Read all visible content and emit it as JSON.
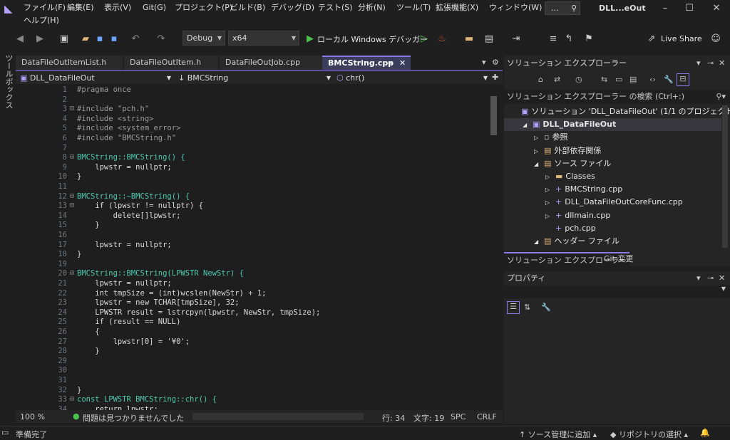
{
  "menu": [
    "ファイル(F)",
    "編集(E)",
    "表示(V)",
    "Git(G)",
    "プロジェクト(P)",
    "ビルド(B)",
    "デバッグ(D)",
    "テスト(S)",
    "分析(N)",
    "ツール(T)",
    "拡張機能(X)",
    "ウィンドウ(W)",
    "ヘルプ(H)"
  ],
  "search": {
    "label": "..."
  },
  "title": "DLL...eOut",
  "toolbar": {
    "config": "Debug",
    "platform": "x64",
    "run_label": "ローカル Windows デバッガー",
    "live_share": "Live Share"
  },
  "toolbox_label": "ツールボックス",
  "tabs": [
    "DataFileOutItemList.h",
    "DataFileOutItem.h",
    "DataFileOutJob.cpp",
    "BMCString.cpp"
  ],
  "nav": {
    "project": "DLL_DataFileOut",
    "scope": "BMCString",
    "member": "chr()"
  },
  "code": [
    {
      "n": "1",
      "t": "#pragma once"
    },
    {
      "n": "2",
      "t": ""
    },
    {
      "n": "3",
      "t": "#include \"pch.h\""
    },
    {
      "n": "4",
      "t": "#include <string>"
    },
    {
      "n": "5",
      "t": "#include <system_error>"
    },
    {
      "n": "6",
      "t": "#include \"BMCString.h\""
    },
    {
      "n": "7",
      "t": ""
    },
    {
      "n": "8",
      "t": "BMCString::BMCString() {"
    },
    {
      "n": "9",
      "t": "    lpwstr = nullptr;"
    },
    {
      "n": "10",
      "t": "}"
    },
    {
      "n": "11",
      "t": ""
    },
    {
      "n": "12",
      "t": "BMCString::~BMCString() {"
    },
    {
      "n": "13",
      "t": "    if (lpwstr != nullptr) {"
    },
    {
      "n": "14",
      "t": "        delete[]lpwstr;"
    },
    {
      "n": "15",
      "t": "    }"
    },
    {
      "n": "16",
      "t": ""
    },
    {
      "n": "17",
      "t": "    lpwstr = nullptr;"
    },
    {
      "n": "18",
      "t": "}"
    },
    {
      "n": "19",
      "t": ""
    },
    {
      "n": "20",
      "t": "BMCString::BMCString(LPWSTR NewStr) {"
    },
    {
      "n": "21",
      "t": "    lpwstr = nullptr;"
    },
    {
      "n": "22",
      "t": "    int tmpSize = (int)wcslen(NewStr) + 1;"
    },
    {
      "n": "23",
      "t": "    lpwstr = new TCHAR[tmpSize], 32;"
    },
    {
      "n": "24",
      "t": "    LPWSTR result = lstrcpyn(lpwstr, NewStr, tmpSize);"
    },
    {
      "n": "25",
      "t": "    if (result == NULL)"
    },
    {
      "n": "26",
      "t": "    {"
    },
    {
      "n": "27",
      "t": "        lpwstr[0] = '¥0';"
    },
    {
      "n": "28",
      "t": "    }"
    },
    {
      "n": "29",
      "t": ""
    },
    {
      "n": "30",
      "t": ""
    },
    {
      "n": "31",
      "t": ""
    },
    {
      "n": "32",
      "t": "}"
    },
    {
      "n": "33",
      "t": "const LPWSTR BMCString::chr() {"
    },
    {
      "n": "34",
      "t": "    return lpwstr;"
    }
  ],
  "editor_status": {
    "zoom": "100 %",
    "issues": "問題は見つかりませんでした",
    "line": "行: 34",
    "col": "文字: 19",
    "spc": "SPC",
    "crlf": "CRLF"
  },
  "solution": {
    "title": "ソリューション エクスプローラー",
    "search": "ソリューション エクスプローラー の検索 (Ctrl+:)",
    "items": [
      {
        "label": "ソリューション 'DLL_DataFileOut' (1/1 のプロジェクト)",
        "indent": 0
      },
      {
        "label": "DLL_DataFileOut",
        "indent": 1
      },
      {
        "label": "参照",
        "indent": 2
      },
      {
        "label": "外部依存関係",
        "indent": 2
      },
      {
        "label": "ソース ファイル",
        "indent": 2
      },
      {
        "label": "Classes",
        "indent": 3
      },
      {
        "label": "BMCString.cpp",
        "indent": 3
      },
      {
        "label": "DLL_DataFileOutCoreFunc.cpp",
        "indent": 3
      },
      {
        "label": "dllmain.cpp",
        "indent": 3
      },
      {
        "label": "pch.cpp",
        "indent": 3
      },
      {
        "label": "ヘッダー ファイル",
        "indent": 2
      }
    ],
    "bottom_tabs": [
      "ソリューション エクスプローラー",
      "Git 変更"
    ]
  },
  "props": {
    "title": "プロパティ"
  },
  "status": {
    "ready": "準備完了",
    "source_control": "ソース管理に追加",
    "repo": "リポジトリの選択"
  }
}
